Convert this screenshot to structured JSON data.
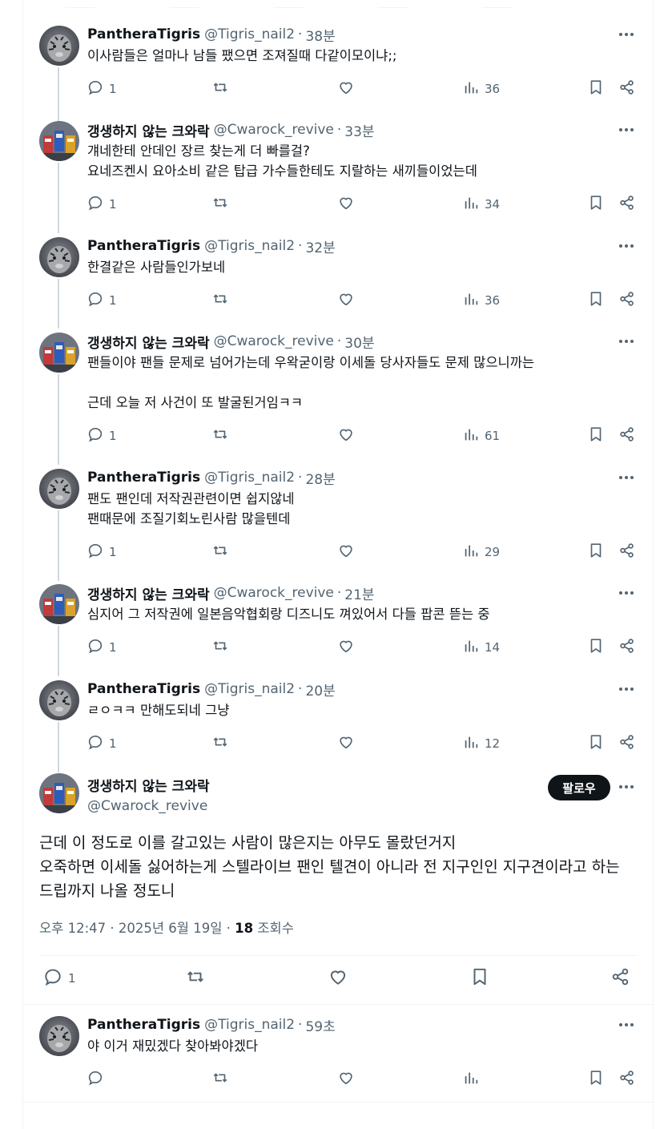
{
  "replies": [
    {
      "name": "PantheraTigris",
      "handle": "@Tigris_nail2",
      "time": "38분",
      "avatar": "tiger",
      "text": "이사람들은 얼마나 남들 팼으면 조져질때 다같이모이냐;;",
      "replies": "1",
      "views": "36"
    },
    {
      "name": "갱생하지 않는 크와락",
      "handle": "@Cwarock_revive",
      "time": "33분",
      "avatar": "robot",
      "text": "걔네한테 안데인 장르 찾는게 더 빠를걸?\n요네즈켄시 요아소비 같은 탑급 가수들한테도 지랄하는 새끼들이었는데",
      "replies": "1",
      "views": "34"
    },
    {
      "name": "PantheraTigris",
      "handle": "@Tigris_nail2",
      "time": "32분",
      "avatar": "tiger",
      "text": "한결같은 사람들인가보네",
      "replies": "1",
      "views": "36"
    },
    {
      "name": "갱생하지 않는 크와락",
      "handle": "@Cwarock_revive",
      "time": "30분",
      "avatar": "robot",
      "text": "팬들이야 팬들 문제로 넘어가는데 우왁굳이랑 이세돌 당사자들도 문제 많으니까는\n\n근데 오늘 저 사건이 또 발굴된거임ㅋㅋ",
      "replies": "1",
      "views": "61"
    },
    {
      "name": "PantheraTigris",
      "handle": "@Tigris_nail2",
      "time": "28분",
      "avatar": "tiger",
      "text": "팬도 팬인데 저작권관련이면 쉽지않네\n팬때문에 조질기회노린사람 많을텐데",
      "replies": "1",
      "views": "29"
    },
    {
      "name": "갱생하지 않는 크와락",
      "handle": "@Cwarock_revive",
      "time": "21분",
      "avatar": "robot",
      "text": "심지어 그 저작권에 일본음악협회랑 디즈니도 껴있어서 다들 팝콘 뜯는 중",
      "replies": "1",
      "views": "14"
    },
    {
      "name": "PantheraTigris",
      "handle": "@Tigris_nail2",
      "time": "20분",
      "avatar": "tiger",
      "text": "ㄹㅇㅋㅋ 만해도되네 그냥",
      "replies": "1",
      "views": "12"
    }
  ],
  "main": {
    "name": "갱생하지 않는 크와락",
    "handle": "@Cwarock_revive",
    "follow_label": "팔로우",
    "text": "근데 이 정도로 이를 갈고있는 사람이 많은지는 아무도 몰랐던거지\n오죽하면 이세돌 싫어하는게 스텔라이브 팬인 텔견이 아니라 전 지구인인 지구견이라고 하는 드립까지 나올 정도니",
    "timestamp": "오후 12:47 · 2025년 6월 19일 · ",
    "views_count": "18",
    "views_label": " 조회수",
    "reply_count": "1"
  },
  "last_reply": {
    "name": "PantheraTigris",
    "handle": "@Tigris_nail2",
    "time": "59초",
    "avatar": "tiger",
    "text": "야 이거 재밌겠다 찾아봐야겠다",
    "replies": "",
    "views": ""
  },
  "colors": {
    "text": "#0f1419",
    "muted": "#536471",
    "line": "#cfd9de",
    "border": "#eff3f4",
    "button": "#0f1419"
  },
  "icons": [
    "reply-icon",
    "retweet-icon",
    "like-icon",
    "views-icon",
    "bookmark-icon",
    "share-icon",
    "more-icon"
  ]
}
